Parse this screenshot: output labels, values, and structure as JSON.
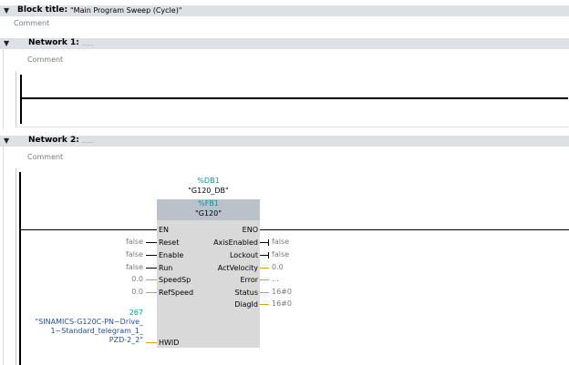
{
  "block": {
    "title_label": "Block title:",
    "title_value": "\"Main Program Sweep (Cycle)\"",
    "comment": "Comment"
  },
  "network1": {
    "title": "Network 1:",
    "dots": ".....",
    "comment": "Comment"
  },
  "network2": {
    "title": "Network 2:",
    "dots": ".....",
    "comment": "Comment"
  },
  "fb": {
    "db_address": "%DB1",
    "db_name": "\"G120_DB\"",
    "fb_address": "%FB1",
    "fb_name": "\"G120\"",
    "inputs": [
      {
        "pin": "EN",
        "value": ""
      },
      {
        "pin": "Reset",
        "value": "false"
      },
      {
        "pin": "Enable",
        "value": "false"
      },
      {
        "pin": "Run",
        "value": "false"
      },
      {
        "pin": "SpeedSp",
        "value": "0.0"
      },
      {
        "pin": "RefSpeed",
        "value": "0.0"
      }
    ],
    "outputs": [
      {
        "pin": "ENO",
        "value": ""
      },
      {
        "pin": "AxisEnabled",
        "value": "false"
      },
      {
        "pin": "Lockout",
        "value": "false"
      },
      {
        "pin": "ActVelocity",
        "value": "0.0"
      },
      {
        "pin": "Error",
        "value": "..."
      },
      {
        "pin": "Status",
        "value": "16#0"
      },
      {
        "pin": "DiagId",
        "value": "16#0"
      }
    ],
    "hwid": {
      "pin": "HWID",
      "number": "267",
      "line1": "\"SINAMICS-G120C-PN~Drive_",
      "line2": "1~Standard_telegram_1_",
      "line3": "PZD-2_2\""
    }
  }
}
